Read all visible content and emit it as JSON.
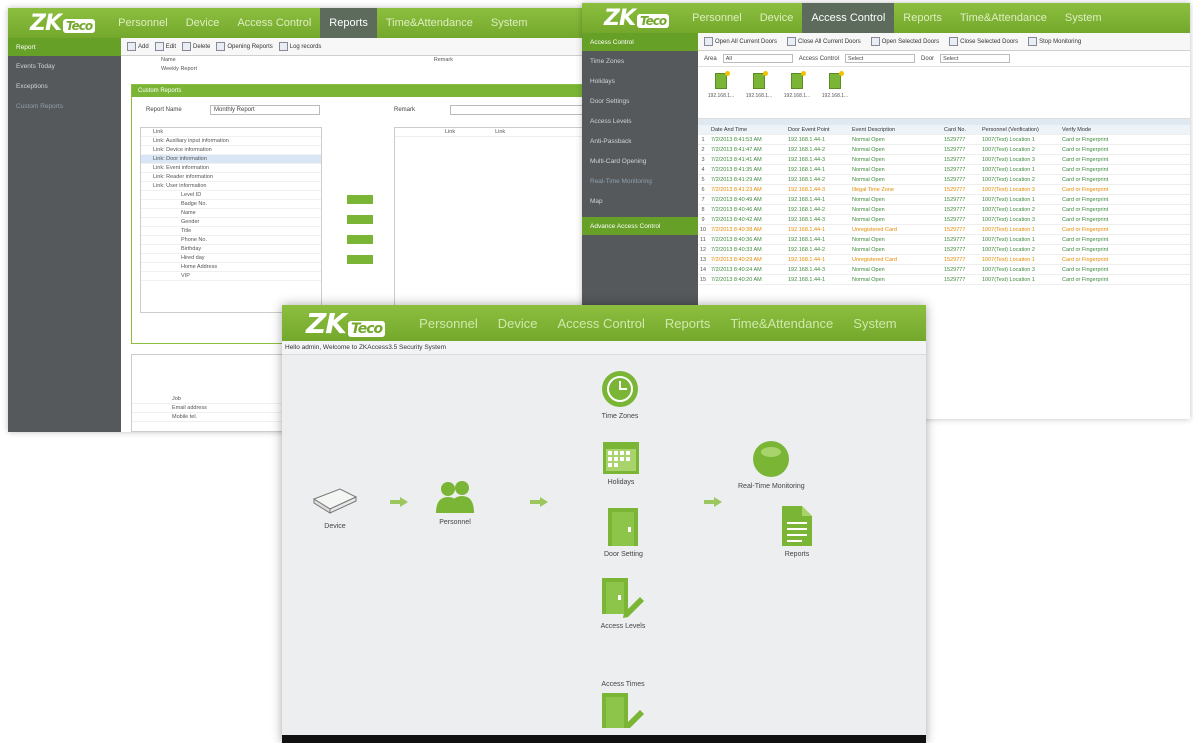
{
  "colors": {
    "brand_green": "#7ab536",
    "sidebar": "#55595c",
    "event_ok": "#3f8a3f",
    "event_warn": "#e58a00"
  },
  "win1": {
    "logo": "ZKTeco",
    "nav": [
      "Personnel",
      "Device",
      "Access Control",
      "Reports",
      "Time&Attendance",
      "System"
    ],
    "active_nav": "Reports",
    "sidebar": [
      "Report",
      "Events Today",
      "Exceptions",
      "Custom Reports"
    ],
    "toolbar": [
      "Add",
      "Edit",
      "Delete",
      "Opening Reports",
      "Log records"
    ],
    "table_header": [
      "Name",
      "Remark"
    ],
    "table_row": "Weekly Report",
    "dialog_title": "Custom Reports",
    "report_name_label": "Report Name",
    "report_name_value": "Monthly Report",
    "remark_label": "Remark",
    "tree": [
      "Link",
      "Link: Auxiliary input information",
      "Link: Device information",
      "Link: Door information",
      "Link: Event information",
      "Link: Reader information",
      "Link: User information",
      "Level ID",
      "Badge No.",
      "Name",
      "Gender",
      "Title",
      "Phone No.",
      "Birthday",
      "Hired day",
      "Home Address",
      "VIP"
    ],
    "right_header": [
      "Link",
      "Link"
    ],
    "lower": [
      "Job",
      "Email address",
      "Mobile tel."
    ]
  },
  "win2": {
    "logo": "ZKTeco",
    "nav": [
      "Personnel",
      "Device",
      "Access Control",
      "Reports",
      "Time&Attendance",
      "System"
    ],
    "active_nav": "Access Control",
    "sidebar": [
      "Access Control",
      "Time Zones",
      "Holidays",
      "Door Settings",
      "Access Levels",
      "Anti-Passback",
      "Multi-Card Opening",
      "Real-Time Monitoring",
      "Map",
      "Advance Access Control"
    ],
    "toolbar": [
      "Open All Current Doors",
      "Close All Current Doors",
      "Open Selected Doors",
      "Close Selected Doors",
      "Stop Monitoring"
    ],
    "filter": {
      "area_label": "Area",
      "area_value": "All",
      "ac_label": "Access Control",
      "ac_value": "Select",
      "door_label": "Door",
      "door_value": "Select"
    },
    "doors": [
      "192.168.1...",
      "192.168.1...",
      "192.168.1...",
      "192.168.1..."
    ],
    "event_header": [
      "Date And Time",
      "Door Event Point",
      "Event Description",
      "Card No.",
      "Personnel (Verification)",
      "Verify Mode"
    ],
    "events": [
      [
        "7/2/2013 8:41:53 AM",
        "192.168.1.44-1",
        "Normal Open",
        "1529777",
        "1007(Test) Location 1",
        "Card or Fingerprint",
        "ok"
      ],
      [
        "7/2/2013 8:41:47 AM",
        "192.168.1.44-2",
        "Normal Open",
        "1529777",
        "1007(Test) Location 2",
        "Card or Fingerprint",
        "ok"
      ],
      [
        "7/2/2013 8:41:41 AM",
        "192.168.1.44-3",
        "Normal Open",
        "1529777",
        "1007(Test) Location 3",
        "Card or Fingerprint",
        "ok"
      ],
      [
        "7/2/2013 8:41:35 AM",
        "192.168.1.44-1",
        "Normal Open",
        "1529777",
        "1007(Test) Location 1",
        "Card or Fingerprint",
        "ok"
      ],
      [
        "7/2/2013 8:41:29 AM",
        "192.168.1.44-2",
        "Normal Open",
        "1529777",
        "1007(Test) Location 2",
        "Card or Fingerprint",
        "ok"
      ],
      [
        "7/2/2013 8:41:23 AM",
        "192.168.1.44-3",
        "Illegal Time Zone",
        "1529777",
        "1007(Test) Location 3",
        "Card or Fingerprint",
        "warn"
      ],
      [
        "7/2/2013 8:40:49 AM",
        "192.168.1.44-1",
        "Normal Open",
        "1529777",
        "1007(Test) Location 1",
        "Card or Fingerprint",
        "ok"
      ],
      [
        "7/2/2013 8:40:46 AM",
        "192.168.1.44-2",
        "Normal Open",
        "1529777",
        "1007(Test) Location 2",
        "Card or Fingerprint",
        "ok"
      ],
      [
        "7/2/2013 8:40:42 AM",
        "192.168.1.44-3",
        "Normal Open",
        "1529777",
        "1007(Test) Location 3",
        "Card or Fingerprint",
        "ok"
      ],
      [
        "7/2/2013 8:40:38 AM",
        "192.168.1.44-1",
        "Unregistered Card",
        "1529777",
        "1007(Test) Location 1",
        "Card or Fingerprint",
        "warn"
      ],
      [
        "7/2/2013 8:40:36 AM",
        "192.168.1.44-1",
        "Normal Open",
        "1529777",
        "1007(Test) Location 1",
        "Card or Fingerprint",
        "ok"
      ],
      [
        "7/2/2013 8:40:33 AM",
        "192.168.1.44-2",
        "Normal Open",
        "1529777",
        "1007(Test) Location 2",
        "Card or Fingerprint",
        "ok"
      ],
      [
        "7/2/2013 8:40:29 AM",
        "192.168.1.44-1",
        "Unregistered Card",
        "1529777",
        "1007(Test) Location 1",
        "Card or Fingerprint",
        "warn"
      ],
      [
        "7/2/2013 8:40:24 AM",
        "192.168.1.44-3",
        "Normal Open",
        "1529777",
        "1007(Test) Location 3",
        "Card or Fingerprint",
        "ok"
      ],
      [
        "7/2/2013 8:40:20 AM",
        "192.168.1.44-1",
        "Normal Open",
        "1529777",
        "1007(Test) Location 1",
        "Card or Fingerprint",
        "ok"
      ]
    ]
  },
  "win3": {
    "logo": "ZKTeco",
    "nav": [
      "Personnel",
      "Device",
      "Access Control",
      "Reports",
      "Time&Attendance",
      "System"
    ],
    "welcome": "Hello admin, Welcome to ZKAccess3.5 Security System",
    "nodes": {
      "device": "Device",
      "personnel": "Personnel",
      "time_zones": "Time Zones",
      "holidays": "Holidays",
      "door_setting": "Door Setting",
      "access_levels": "Access Levels",
      "access_times": "Access Times",
      "real_time": "Real-Time Monitoring",
      "reports": "Reports"
    }
  }
}
